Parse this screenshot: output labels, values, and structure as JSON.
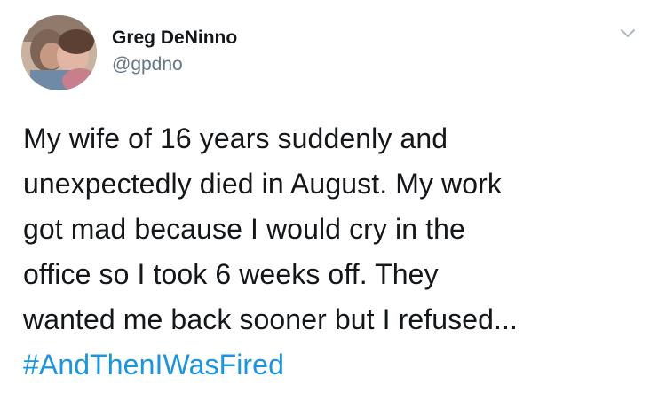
{
  "tweet": {
    "author": {
      "display_name": "Greg DeNinno",
      "handle": "@gpdno",
      "avatar_icon": "profile-photo"
    },
    "menu_icon": "chevron-down-icon",
    "text_lines": [
      "My wife of 16 years suddenly and",
      "unexpectedly died in August. My work",
      "got mad because I would cry in the",
      "office so I took 6 weeks off. They",
      "wanted me back sooner but I refused..."
    ],
    "hashtag": "#AndThenIWasFired"
  },
  "colors": {
    "text": "#14171a",
    "secondary_text": "#657786",
    "link": "#1b95e0",
    "caret": "#aab8c2"
  }
}
